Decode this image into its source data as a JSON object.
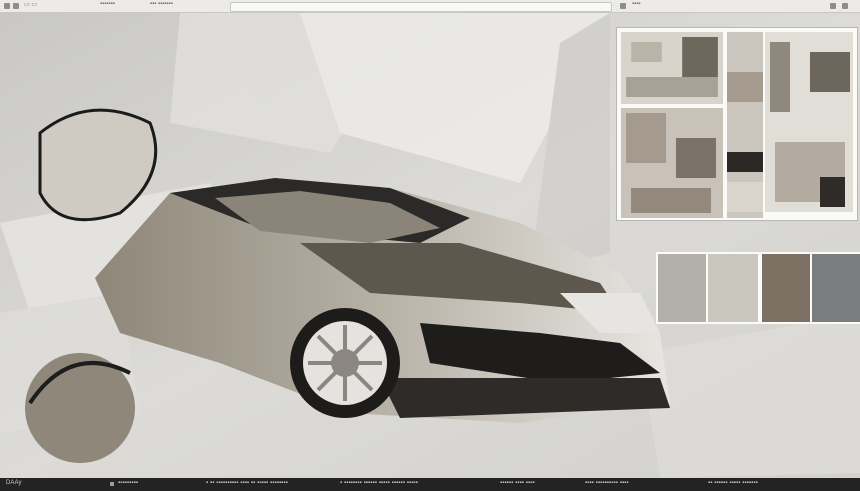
{
  "topbar": {
    "items": [
      "▭  ▭",
      "▪▪▪▪▪▪▪",
      "▪▪▪ ▪▪▪▪▪▪▪",
      "▪▪▪▪"
    ],
    "url_value": ""
  },
  "artwork": {
    "subject": "abstract grayscale sports car illustration"
  },
  "thumbnail_panel": {
    "count": 5
  },
  "palette": {
    "colors": [
      "#b3b0aa",
      "#cac7bf",
      "#7d7164",
      "#7c7d7e"
    ]
  },
  "statusbar": {
    "items": [
      "DAAy",
      "▪▪▪▪▪▪▪▪▪",
      "▪ ▪▪ ▪▪▪▪▪▪▪▪▪▪ ▪▪▪▪ ▪▪ ▪▪▪▪▪ ▪▪▪▪▪▪▪▪",
      "▪ ▪▪▪▪▪▪▪▪ ▪▪▪▪▪▪ ▪▪▪▪▪ ▪▪▪▪▪▪ ▪▪▪▪▪",
      "▪▪▪▪▪▪ ▪▪▪▪ ▪▪▪▪",
      "▪▪▪▪ ▪▪▪▪▪▪▪▪▪▪ ▪▪▪▪",
      "▪▪ ▪▪▪▪▪▪ ▪▪▪▪▪ ▪▪▪▪▪▪▪"
    ]
  },
  "colors": {
    "background": "#d5d4d0",
    "toolbar": "#ecebe7",
    "statusbar": "#232323",
    "ink": "#1f1f1f"
  }
}
